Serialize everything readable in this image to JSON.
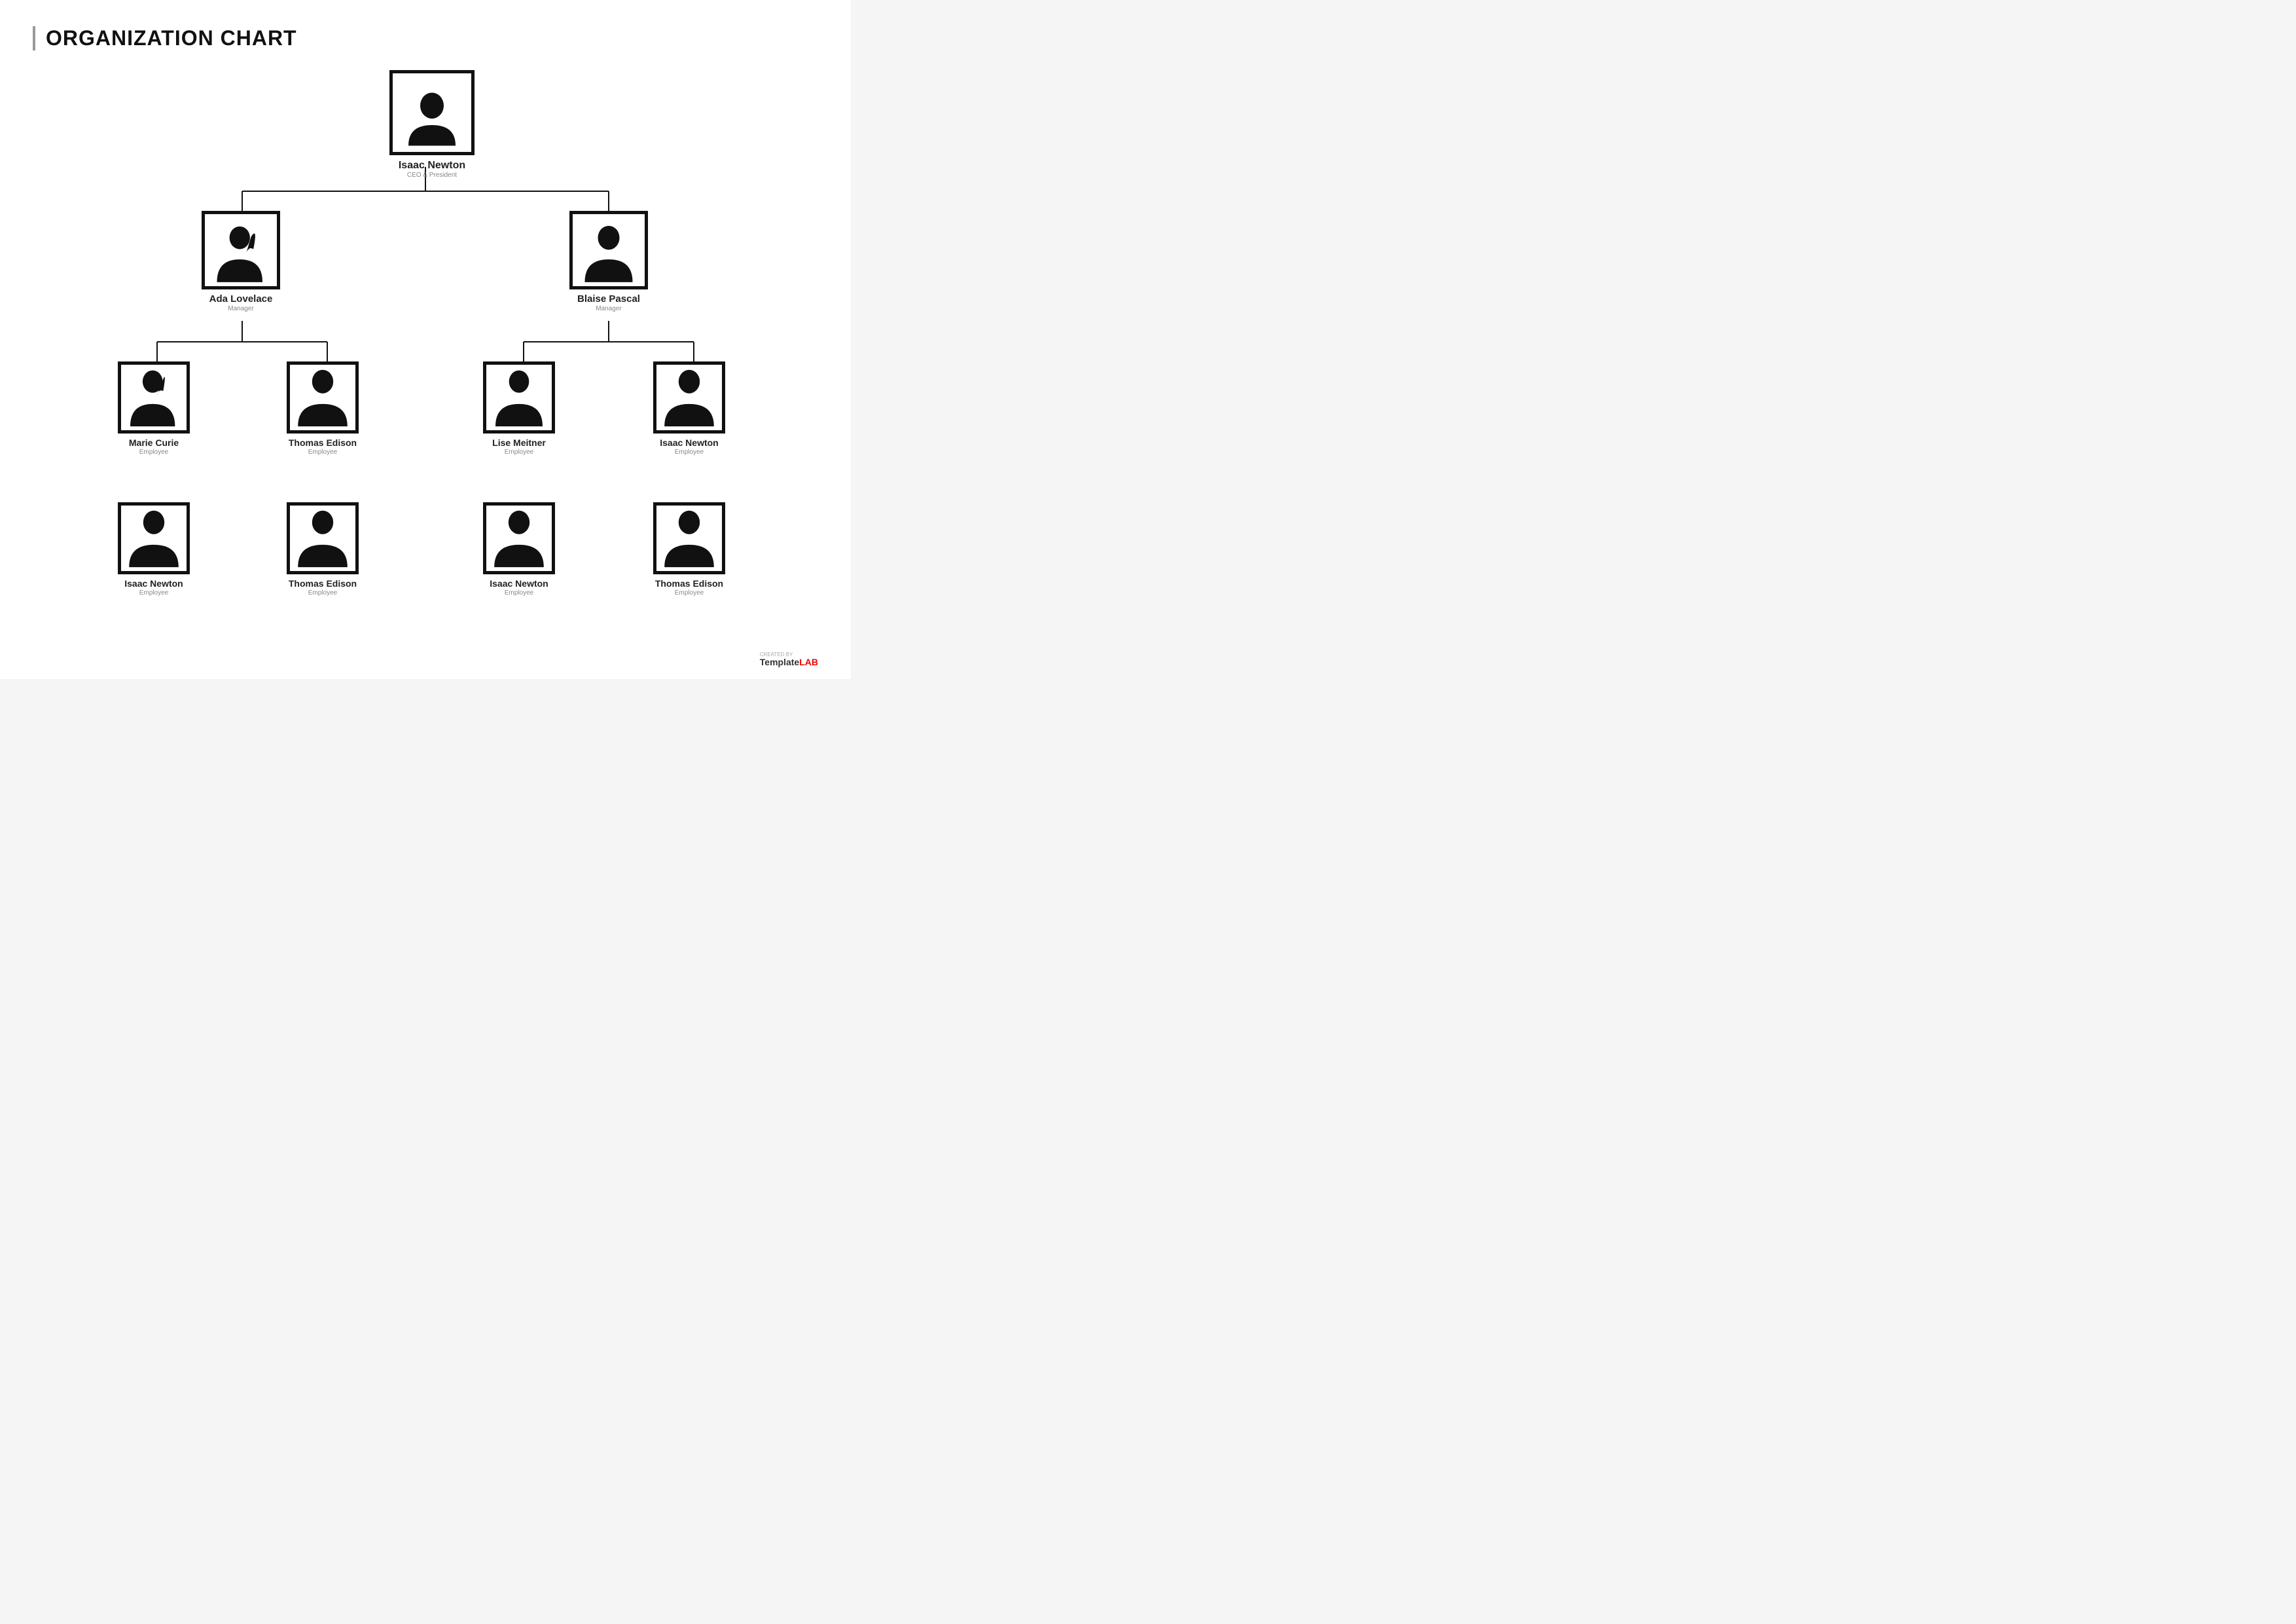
{
  "title": "ORGANIZATION CHART",
  "ceo": {
    "name": "Isaac Newton",
    "role": "CEO & President"
  },
  "managers": [
    {
      "name": "Ada Lovelace",
      "role": "Manager",
      "gender": "female"
    },
    {
      "name": "Blaise Pascal",
      "role": "Manager",
      "gender": "male"
    }
  ],
  "employees_row1": [
    {
      "name": "Marie Curie",
      "role": "Employee",
      "gender": "female"
    },
    {
      "name": "Thomas Edison",
      "role": "Employee",
      "gender": "male"
    },
    {
      "name": "Lise Meitner",
      "role": "Employee",
      "gender": "female2"
    },
    {
      "name": "Isaac Newton",
      "role": "Employee",
      "gender": "male2"
    }
  ],
  "employees_row2": [
    {
      "name": "Isaac Newton",
      "role": "Employee",
      "gender": "male3"
    },
    {
      "name": "Thomas Edison",
      "role": "Employee",
      "gender": "male"
    },
    {
      "name": "Isaac Newton",
      "role": "Employee",
      "gender": "male2"
    },
    {
      "name": "Thomas Edison",
      "role": "Employee",
      "gender": "male3"
    }
  ],
  "watermark": {
    "created_by": "CREATED BY",
    "brand_template": "Template",
    "brand_lab": "LAB"
  }
}
